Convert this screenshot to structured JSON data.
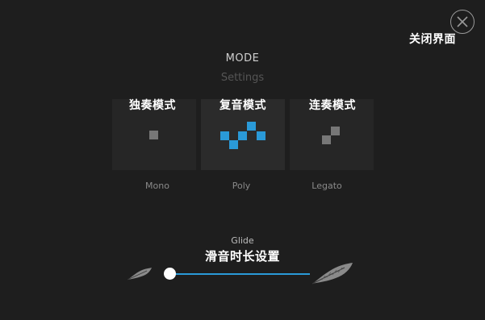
{
  "header": {
    "close_annotation": "关闭界面",
    "title": "MODE",
    "subtitle": "Settings"
  },
  "modes": {
    "mono": {
      "label": "Mono",
      "annotation": "独奏模式"
    },
    "poly": {
      "label": "Poly",
      "annotation": "复音模式",
      "selected": true
    },
    "legato": {
      "label": "Legato",
      "annotation": "连奏模式"
    }
  },
  "glide": {
    "label": "Glide",
    "annotation": "滑音时长设置",
    "value": 0
  },
  "colors": {
    "background": "#1e1e1e",
    "accent": "#2a9ad8",
    "tile": "#262626",
    "inactive_pixel": "#777777"
  },
  "icons": {
    "close": "close-icon",
    "glide_min": "feather-small-icon",
    "glide_max": "feather-large-icon"
  }
}
